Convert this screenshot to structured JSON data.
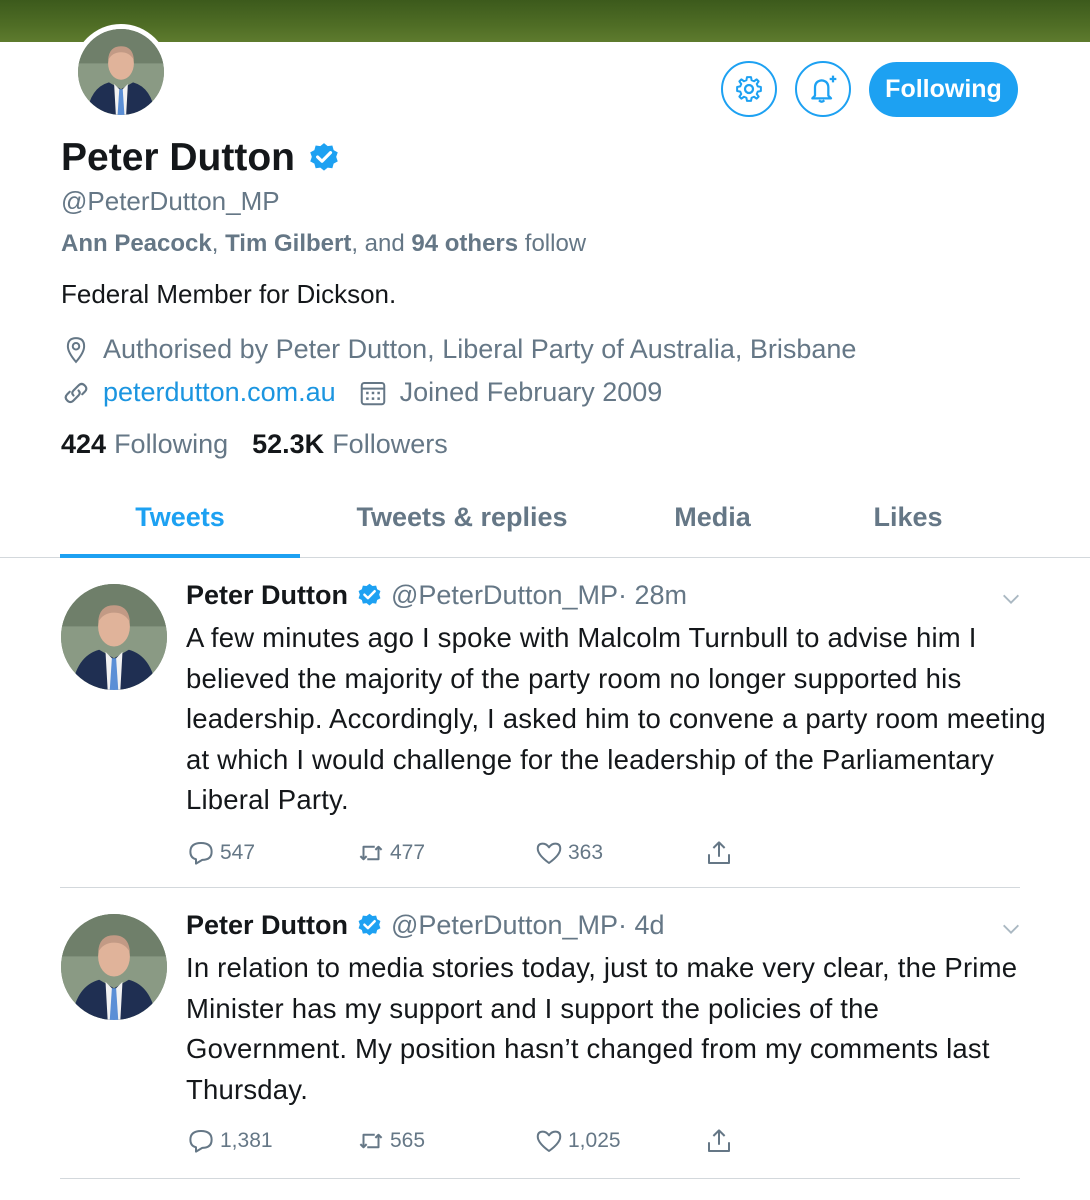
{
  "profile": {
    "name": "Peter Dutton",
    "handle": "@PeterDutton_MP",
    "followed_by": {
      "name1": "Ann Peacock",
      "name2": "Tim Gilbert",
      "sep": ",",
      "and": "and",
      "others": "94 others",
      "follow": "follow"
    },
    "bio": "Federal Member for Dickson.",
    "location": "Authorised by Peter Dutton, Liberal Party of Australia, Brisbane",
    "website": "peterdutton.com.au",
    "joined": "Joined February 2009",
    "following_count": "424",
    "following_label": "Following",
    "followers_count": "52.3K",
    "followers_label": "Followers"
  },
  "buttons": {
    "follow_label": "Following",
    "settings_icon": "gear-icon",
    "notify_icon": "bell-plus-icon"
  },
  "tabs": [
    {
      "label": "Tweets",
      "active": true
    },
    {
      "label": "Tweets & replies",
      "active": false
    },
    {
      "label": "Media",
      "active": false
    },
    {
      "label": "Likes",
      "active": false
    }
  ],
  "tweets": [
    {
      "name": "Peter Dutton",
      "handle": "@PeterDutton_MP",
      "time": "· 28m",
      "text": "A few minutes ago I spoke with Malcolm Turnbull to advise him I believed the majority of the party room no longer supported his leadership. Accordingly, I asked him to convene a party room meeting at which I would challenge for the leadership of the Parliamentary Liberal Party.",
      "replies": "547",
      "retweets": "477",
      "likes": "363"
    },
    {
      "name": "Peter Dutton",
      "handle": "@PeterDutton_MP",
      "time": "· 4d",
      "text": "In relation to media stories today, just to make very clear, the Prime Minister has my support and I support the policies of the Government. My position hasn’t changed from my comments last Thursday.",
      "replies": "1,381",
      "retweets": "565",
      "likes": "1,025"
    }
  ],
  "colors": {
    "accent": "#1da1f2",
    "link": "#1b95e0",
    "muted": "#657786",
    "text": "#14171a",
    "banner": "#4f6d25"
  }
}
